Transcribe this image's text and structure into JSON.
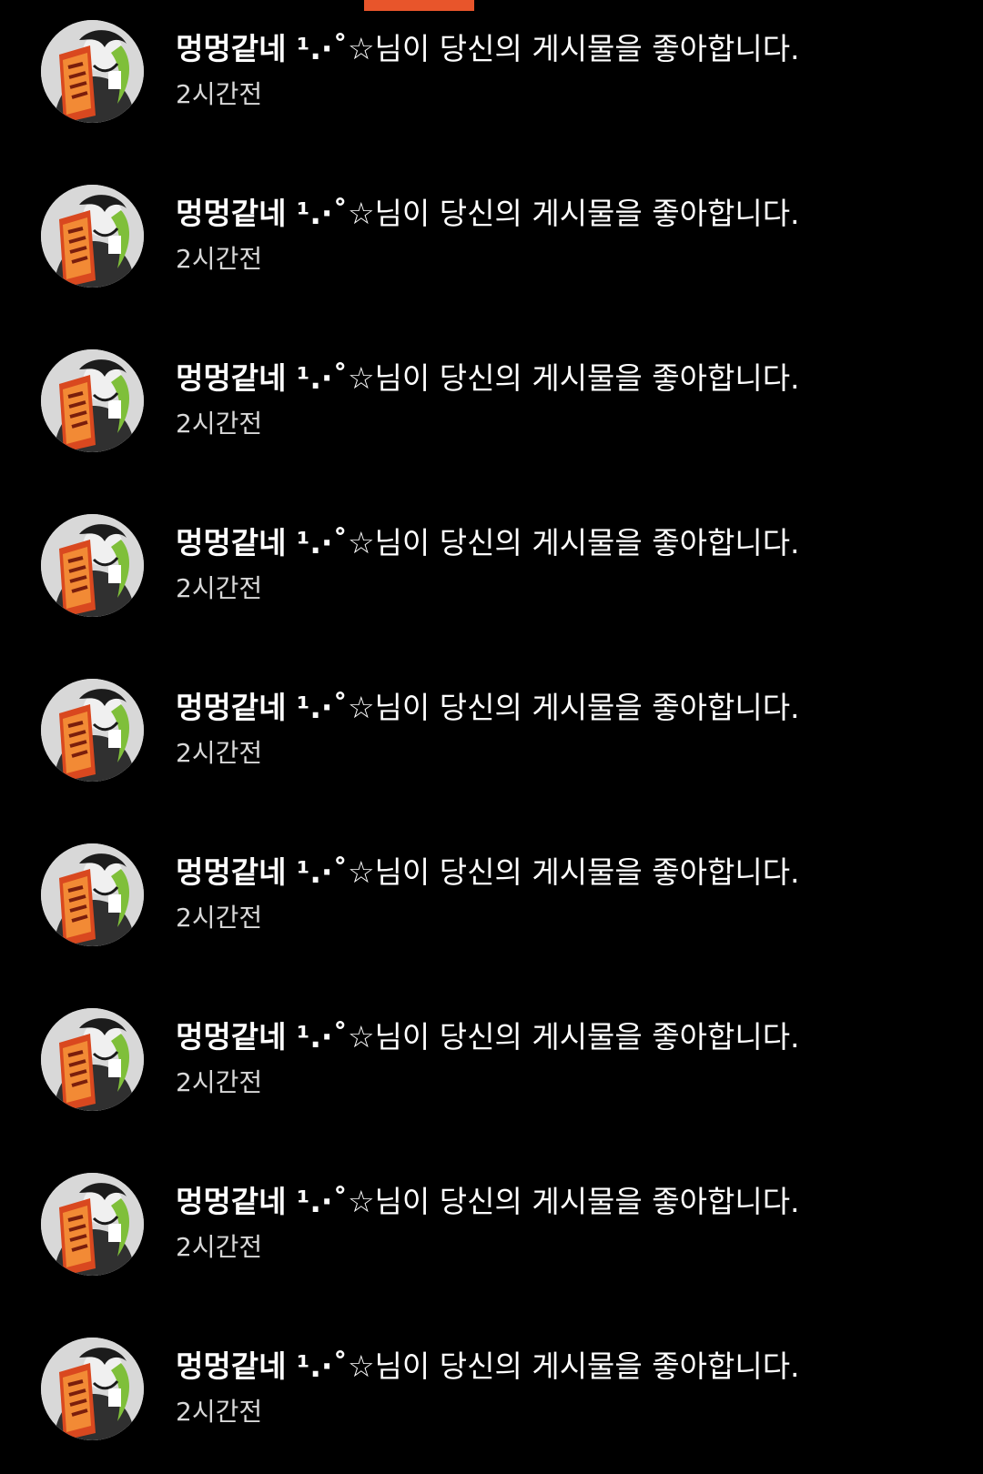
{
  "colors": {
    "background": "#000000",
    "accent": "#e8552b",
    "text_primary": "#ffffff",
    "text_secondary": "#d8d8d8"
  },
  "notifications": [
    {
      "username": "멍멍같네 ¹.·˚",
      "action": "☆님이 당신의 게시물을 좋아합니다.",
      "time": "2시간전",
      "avatar_icon": "profile-avatar-icon"
    },
    {
      "username": "멍멍같네 ¹.·˚",
      "action": "☆님이 당신의 게시물을 좋아합니다.",
      "time": "2시간전",
      "avatar_icon": "profile-avatar-icon"
    },
    {
      "username": "멍멍같네 ¹.·˚",
      "action": "☆님이 당신의 게시물을 좋아합니다.",
      "time": "2시간전",
      "avatar_icon": "profile-avatar-icon"
    },
    {
      "username": "멍멍같네 ¹.·˚",
      "action": "☆님이 당신의 게시물을 좋아합니다.",
      "time": "2시간전",
      "avatar_icon": "profile-avatar-icon"
    },
    {
      "username": "멍멍같네 ¹.·˚",
      "action": "☆님이 당신의 게시물을 좋아합니다.",
      "time": "2시간전",
      "avatar_icon": "profile-avatar-icon"
    },
    {
      "username": "멍멍같네 ¹.·˚",
      "action": "☆님이 당신의 게시물을 좋아합니다.",
      "time": "2시간전",
      "avatar_icon": "profile-avatar-icon"
    },
    {
      "username": "멍멍같네 ¹.·˚",
      "action": "☆님이 당신의 게시물을 좋아합니다.",
      "time": "2시간전",
      "avatar_icon": "profile-avatar-icon"
    },
    {
      "username": "멍멍같네 ¹.·˚",
      "action": "☆님이 당신의 게시물을 좋아합니다.",
      "time": "2시간전",
      "avatar_icon": "profile-avatar-icon"
    },
    {
      "username": "멍멍같네 ¹.·˚",
      "action": "☆님이 당신의 게시물을 좋아합니다.",
      "time": "2시간전",
      "avatar_icon": "profile-avatar-icon"
    }
  ]
}
